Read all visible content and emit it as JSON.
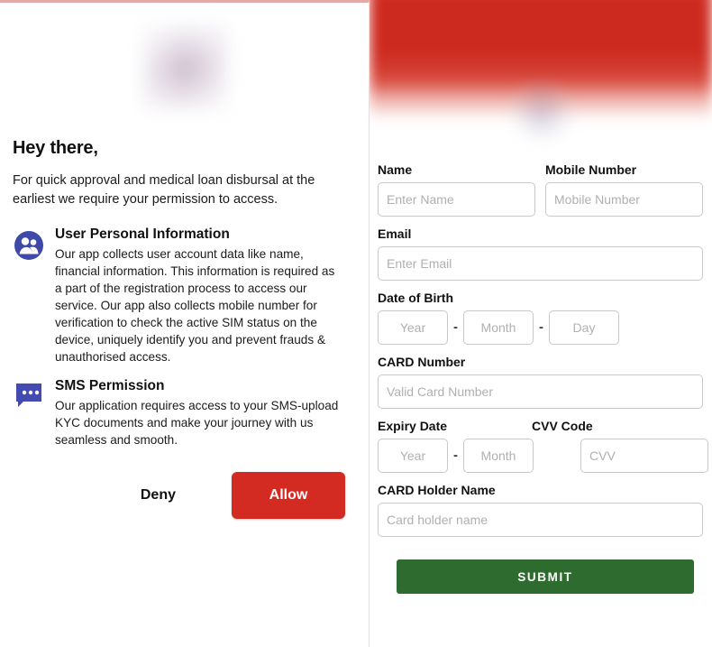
{
  "permission_dialog": {
    "logo_icon": "app-logo-blurred",
    "heading": "Hey there,",
    "intro": "For quick approval and medical loan disbursal at the earliest we require your permission to access.",
    "permissions": [
      {
        "icon": "user-group-icon",
        "title": "User Personal Information",
        "description": "Our app collects user account data like name, financial information. This information is required as a part of the registration process to access our service. Our app also collects mobile number for verification to check the active SIM status on the device, uniquely identify you and prevent frauds & unauthorised access."
      },
      {
        "icon": "sms-bubble-icon",
        "title": "SMS Permission",
        "description": "Our application requires access to your SMS-upload KYC documents and make your journey with us seamless and smooth."
      }
    ],
    "deny_label": "Deny",
    "allow_label": "Allow",
    "allow_color": "#d32a21",
    "top_border_color": "#e3aaa6"
  },
  "kyc_form": {
    "header_color": "#cd2a1f",
    "header_logo_icon": "brand-logo-blurred",
    "fields": {
      "name": {
        "label": "Name",
        "value": "",
        "placeholder": "Enter Name"
      },
      "mobile": {
        "label": "Mobile Number",
        "value": "",
        "placeholder": "Mobile Number"
      },
      "email": {
        "label": "Email",
        "value": "",
        "placeholder": "Enter Email"
      },
      "dob": {
        "label": "Date of Birth",
        "year": {
          "value": "",
          "placeholder": "Year"
        },
        "month": {
          "value": "",
          "placeholder": "Month"
        },
        "day": {
          "value": "",
          "placeholder": "Day"
        },
        "separator": "-"
      },
      "card_number": {
        "label": "CARD Number",
        "value": "",
        "placeholder": "Valid Card Number"
      },
      "expiry": {
        "label": "Expiry Date",
        "year": {
          "value": "",
          "placeholder": "Year"
        },
        "month": {
          "value": "",
          "placeholder": "Month"
        },
        "separator": "-"
      },
      "cvv": {
        "label": "CVV Code",
        "value": "",
        "placeholder": "CVV"
      },
      "card_holder": {
        "label": "CARD Holder Name",
        "value": "",
        "placeholder": "Card holder name"
      }
    },
    "submit_label": "SUBMIT",
    "submit_color": "#2e6b2e"
  }
}
